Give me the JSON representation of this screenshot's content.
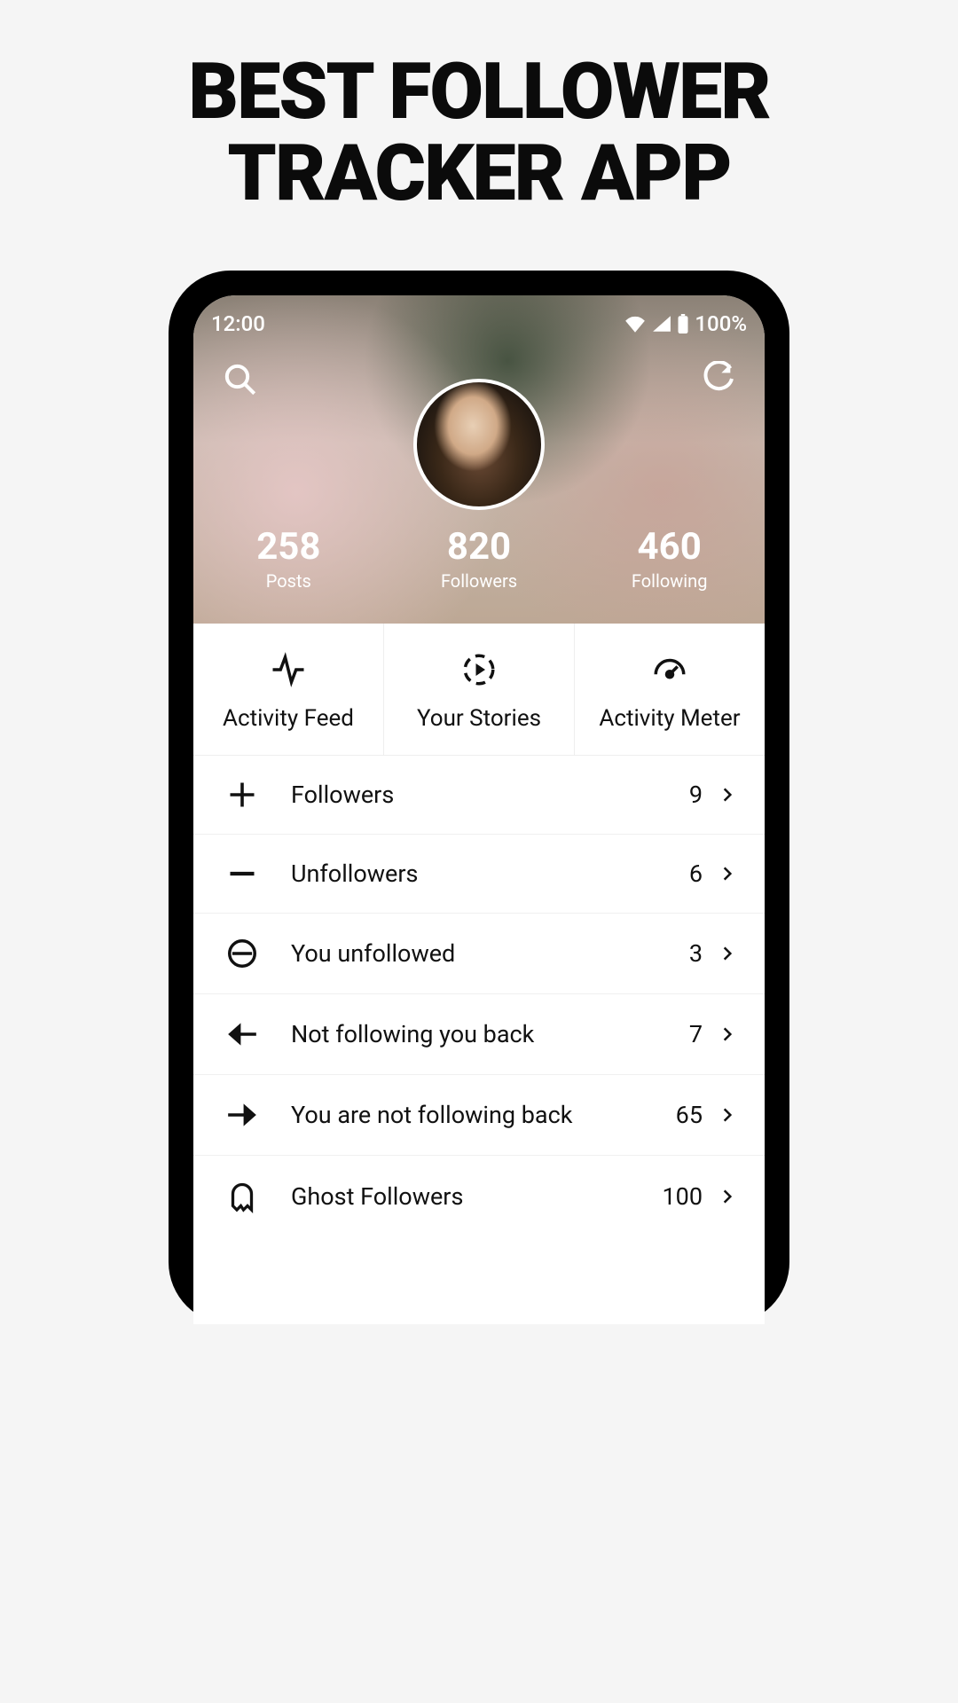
{
  "hero": {
    "line1": "BEST FOLLOWER",
    "line2": "TRACKER APP"
  },
  "status": {
    "time": "12:00",
    "battery": "100%"
  },
  "profile": {
    "stats": [
      {
        "value": "258",
        "label": "Posts"
      },
      {
        "value": "820",
        "label": "Followers"
      },
      {
        "value": "460",
        "label": "Following"
      }
    ]
  },
  "tabs": [
    {
      "label": "Activity Feed"
    },
    {
      "label": "Your Stories"
    },
    {
      "label": "Activity Meter"
    }
  ],
  "rows": [
    {
      "label": "Followers",
      "count": "9"
    },
    {
      "label": "Unfollowers",
      "count": "6"
    },
    {
      "label": "You unfollowed",
      "count": "3"
    },
    {
      "label": "Not following you back",
      "count": "7"
    },
    {
      "label": "You are not following back",
      "count": "65"
    },
    {
      "label": "Ghost Followers",
      "count": "100"
    }
  ]
}
